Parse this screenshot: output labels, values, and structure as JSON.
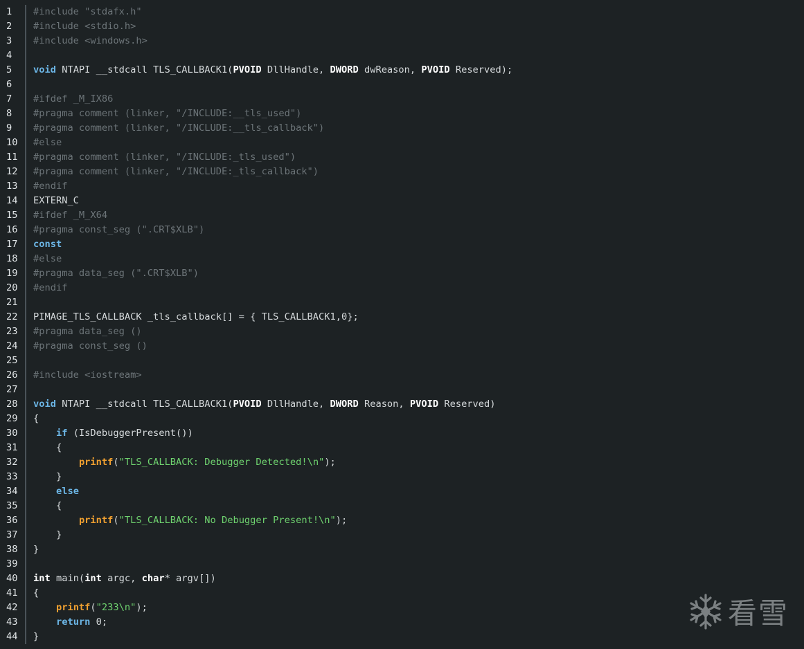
{
  "editor": {
    "lines": [
      [
        [
          "pp",
          "#include \"stdafx.h\""
        ]
      ],
      [
        [
          "pp",
          "#include <stdio.h>"
        ]
      ],
      [
        [
          "pp",
          "#include <windows.h>"
        ]
      ],
      [],
      [
        [
          "kw",
          "void"
        ],
        [
          "plain",
          " NTAPI __stdcall TLS_CALLBACK1("
        ],
        [
          "type",
          "PVOID"
        ],
        [
          "plain",
          " DllHandle, "
        ],
        [
          "type",
          "DWORD"
        ],
        [
          "plain",
          " dwReason, "
        ],
        [
          "type",
          "PVOID"
        ],
        [
          "plain",
          " Reserved);"
        ]
      ],
      [],
      [
        [
          "pp",
          "#ifdef _M_IX86"
        ]
      ],
      [
        [
          "pp",
          "#pragma comment (linker, \"/INCLUDE:__tls_used\")"
        ]
      ],
      [
        [
          "pp",
          "#pragma comment (linker, \"/INCLUDE:__tls_callback\")"
        ]
      ],
      [
        [
          "pp",
          "#else"
        ]
      ],
      [
        [
          "pp",
          "#pragma comment (linker, \"/INCLUDE:_tls_used\")"
        ]
      ],
      [
        [
          "pp",
          "#pragma comment (linker, \"/INCLUDE:_tls_callback\")"
        ]
      ],
      [
        [
          "pp",
          "#endif"
        ]
      ],
      [
        [
          "plain",
          "EXTERN_C"
        ]
      ],
      [
        [
          "pp",
          "#ifdef _M_X64"
        ]
      ],
      [
        [
          "pp",
          "#pragma const_seg (\".CRT$XLB\")"
        ]
      ],
      [
        [
          "kw",
          "const"
        ]
      ],
      [
        [
          "pp",
          "#else"
        ]
      ],
      [
        [
          "pp",
          "#pragma data_seg (\".CRT$XLB\")"
        ]
      ],
      [
        [
          "pp",
          "#endif"
        ]
      ],
      [],
      [
        [
          "plain",
          "PIMAGE_TLS_CALLBACK _tls_callback[] = { TLS_CALLBACK1,0};"
        ]
      ],
      [
        [
          "pp",
          "#pragma data_seg ()"
        ]
      ],
      [
        [
          "pp",
          "#pragma const_seg ()"
        ]
      ],
      [],
      [
        [
          "pp",
          "#include <iostream>"
        ]
      ],
      [],
      [
        [
          "kw",
          "void"
        ],
        [
          "plain",
          " NTAPI __stdcall TLS_CALLBACK1("
        ],
        [
          "type",
          "PVOID"
        ],
        [
          "plain",
          " DllHandle, "
        ],
        [
          "type",
          "DWORD"
        ],
        [
          "plain",
          " Reason, "
        ],
        [
          "type",
          "PVOID"
        ],
        [
          "plain",
          " Reserved)"
        ]
      ],
      [
        [
          "plain",
          "{"
        ]
      ],
      [
        [
          "plain",
          "    "
        ],
        [
          "kw",
          "if"
        ],
        [
          "plain",
          " (IsDebuggerPresent())"
        ]
      ],
      [
        [
          "plain",
          "    {"
        ]
      ],
      [
        [
          "plain",
          "        "
        ],
        [
          "fn",
          "printf"
        ],
        [
          "plain",
          "("
        ],
        [
          "str",
          "\"TLS_CALLBACK: Debugger Detected!\\n\""
        ],
        [
          "plain",
          ");"
        ]
      ],
      [
        [
          "plain",
          "    }"
        ]
      ],
      [
        [
          "plain",
          "    "
        ],
        [
          "kw",
          "else"
        ]
      ],
      [
        [
          "plain",
          "    {"
        ]
      ],
      [
        [
          "plain",
          "        "
        ],
        [
          "fn",
          "printf"
        ],
        [
          "plain",
          "("
        ],
        [
          "str",
          "\"TLS_CALLBACK: No Debugger Present!\\n\""
        ],
        [
          "plain",
          ");"
        ]
      ],
      [
        [
          "plain",
          "    }"
        ]
      ],
      [
        [
          "plain",
          "}"
        ]
      ],
      [],
      [
        [
          "type",
          "int"
        ],
        [
          "plain",
          " main("
        ],
        [
          "type",
          "int"
        ],
        [
          "plain",
          " argc, "
        ],
        [
          "type",
          "char"
        ],
        [
          "plain",
          "* argv[])"
        ]
      ],
      [
        [
          "plain",
          "{"
        ]
      ],
      [
        [
          "plain",
          "    "
        ],
        [
          "fn",
          "printf"
        ],
        [
          "plain",
          "("
        ],
        [
          "str",
          "\"233\\n\""
        ],
        [
          "plain",
          ");"
        ]
      ],
      [
        [
          "plain",
          "    "
        ],
        [
          "kw",
          "return"
        ],
        [
          "plain",
          " 0;"
        ]
      ],
      [
        [
          "plain",
          "}"
        ]
      ]
    ]
  },
  "watermark": {
    "text": "看雪",
    "icon": "snowflake-icon"
  },
  "colors": {
    "background": "#1d2224",
    "keyword": "#6cb6e6",
    "type": "#ffffff",
    "function": "#f0a030",
    "string": "#6fd36f",
    "preprocessor": "#6c7478",
    "plain": "#d5d9db"
  }
}
